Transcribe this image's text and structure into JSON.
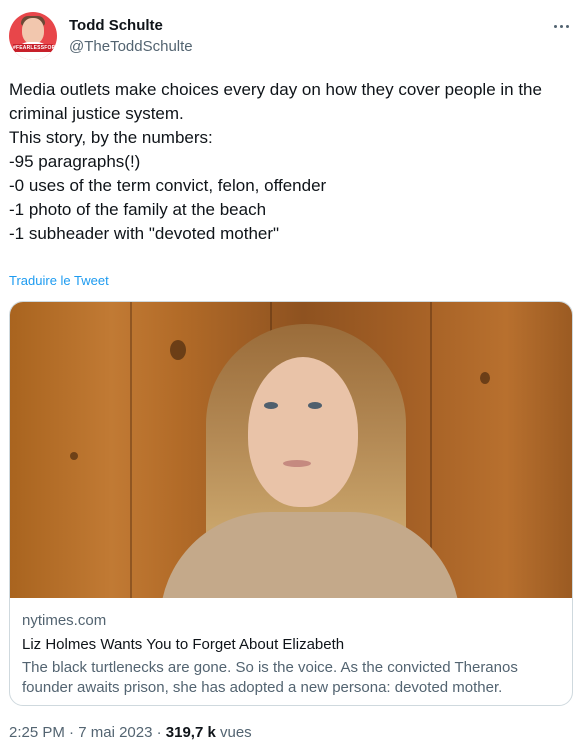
{
  "author": {
    "name": "Todd Schulte",
    "handle": "@TheToddSchulte",
    "avatar_badge": "#FEARLESSFORM"
  },
  "tweet": {
    "lines": [
      "Media outlets make choices every day on how they cover people in the",
      "criminal justice system.",
      "",
      "This story, by the numbers:",
      "-95 paragraphs(!)",
      "-0 uses of the term convict, felon, offender",
      "-1 photo of the family at the beach",
      "-1 subheader with \"devoted mother\""
    ],
    "translate_link": "Traduire le Tweet"
  },
  "card": {
    "domain": "nytimes.com",
    "title": "Liz Holmes Wants You to Forget About Elizabeth",
    "description_lines": [
      "The black turtlenecks are gone. So is the voice. As the convicted Theranos",
      "founder awaits prison, she has adopted a new persona: devoted mother."
    ]
  },
  "meta": {
    "time": "2:25 PM",
    "date": "7 mai 2023",
    "views_count": "319,7 k",
    "views_label": "vues"
  },
  "icons": {
    "more": "more-horizontal-icon"
  }
}
